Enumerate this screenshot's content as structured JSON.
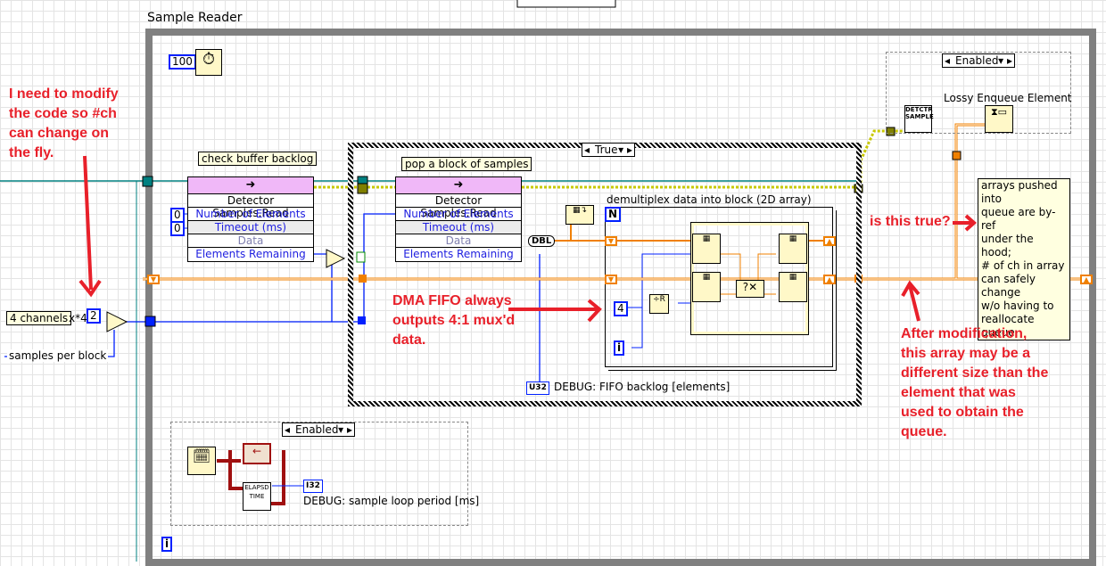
{
  "loop": {
    "title": "Sample Reader",
    "wait_constant": "100",
    "iteration_terminal": "i"
  },
  "annotations": {
    "modify": [
      "I need to modify",
      "the code so #ch",
      "can change on",
      "the fly."
    ],
    "dma": [
      "DMA FIFO always",
      "outputs 4:1 mux'd",
      "data."
    ],
    "question": "is this true?",
    "after": [
      "After modification,",
      "this array may be a",
      "different size than the",
      "element that was",
      "used to obtain the",
      "queue."
    ]
  },
  "inputs": {
    "channels_label": "4 channels",
    "multiplier_label": "x*4",
    "channels_constant": "2",
    "samples_label": "samples per block"
  },
  "case_structure": {
    "selector": "True"
  },
  "nodes": [
    {
      "comment": "check buffer backlog",
      "title": "Detector Samples.Read",
      "rows": [
        "Number of Elements",
        "Timeout (ms)",
        "Data",
        "Elements Remaining"
      ],
      "constants": [
        "0",
        "0"
      ]
    },
    {
      "comment": "pop a block of samples",
      "title": "Detector Samples.Read",
      "rows": [
        "Number of Elements",
        "Timeout (ms)",
        "Data",
        "Elements Remaining"
      ]
    }
  ],
  "conversion": "DBL",
  "for_loop": {
    "label": "demultiplex data into block (2D array)",
    "count_terminal": "N",
    "divisor_constant": "4",
    "iteration_terminal": "i"
  },
  "debug_fifo": {
    "type": "U32",
    "label": "DEBUG: FIFO backlog [elements]"
  },
  "debug_period": {
    "selector": "Enabled",
    "type": "I32",
    "label": "DEBUG: sample loop period [ms]",
    "elapsed_icon": "ELAPSD TIME"
  },
  "enqueue": {
    "selector": "Enabled",
    "label": "Lossy Enqueue Element",
    "type_icon": "DETCTR SAMPLE"
  },
  "queue_comment": [
    "arrays pushed into",
    "queue are by-ref",
    "under the hood;",
    "# of ch in array",
    "can safely change",
    "w/o having to",
    "reallocate queue."
  ],
  "colors": {
    "annotation": "#e8202a",
    "wire_int": "#0020ff",
    "wire_dbl": "#f08000",
    "wire_error": "#c8c800",
    "structure": "#808080"
  }
}
